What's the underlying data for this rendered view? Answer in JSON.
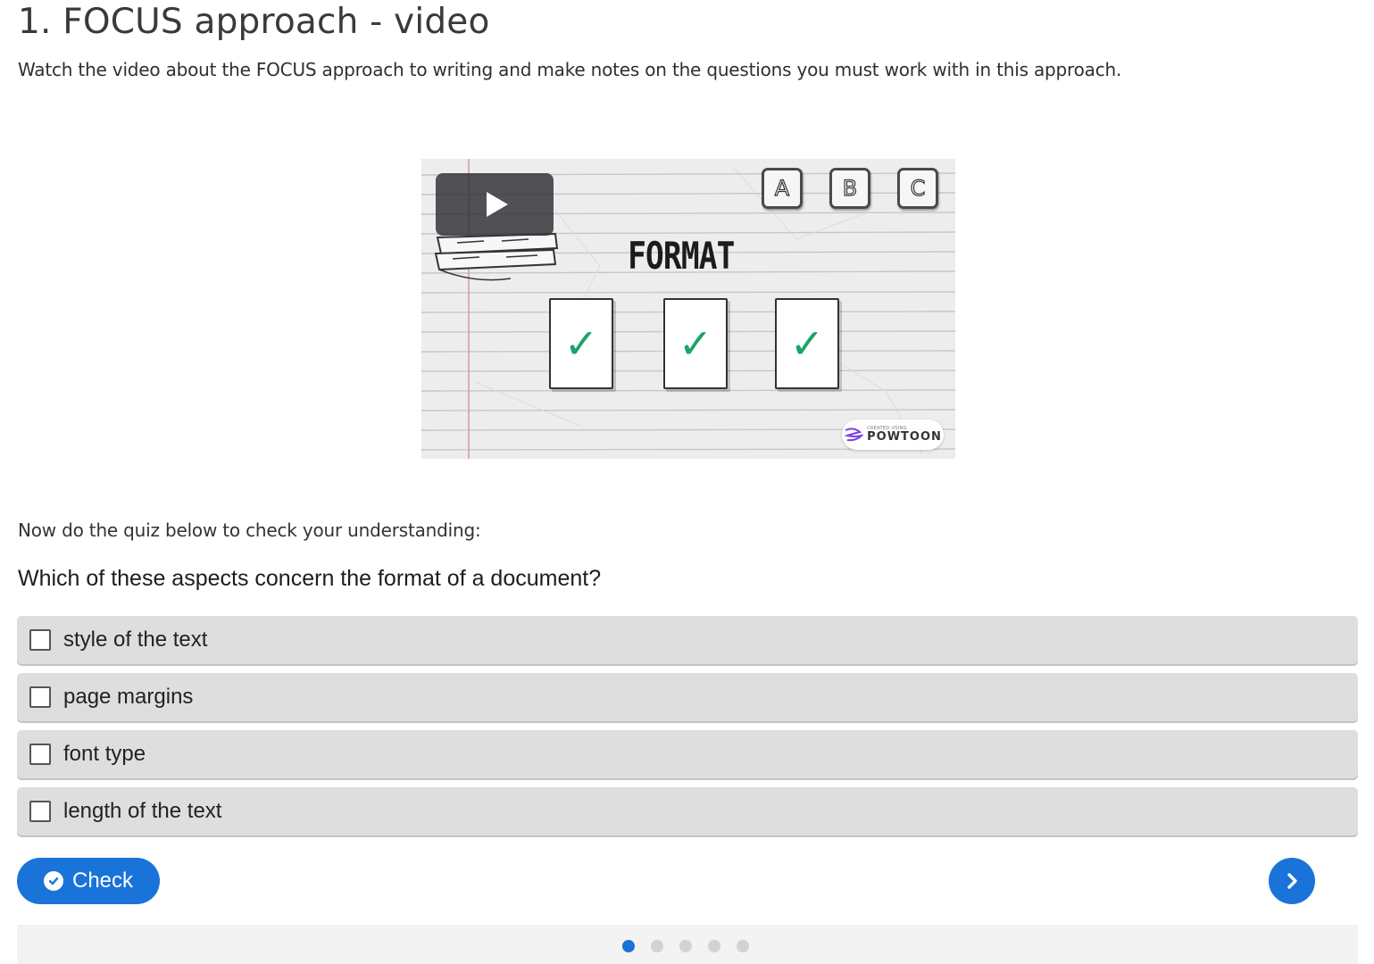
{
  "header": {
    "title": "1. FOCUS approach - video",
    "intro": "Watch the video about the FOCUS approach to writing and make notes on the questions you must work with in this approach."
  },
  "video": {
    "headline": "FORMAT",
    "badges": [
      "A",
      "B",
      "C"
    ],
    "checkmarks": [
      "✓",
      "✓",
      "✓"
    ],
    "watermark_small": "CREATED USING",
    "watermark_name": "POWTOON",
    "play_icon": "play-icon"
  },
  "quiz": {
    "intro": "Now do the quiz below to check your understanding:",
    "question": "Which of these aspects concern the format of a document?",
    "options": [
      {
        "label": "style of the text",
        "checked": false
      },
      {
        "label": "page margins",
        "checked": false
      },
      {
        "label": "font type",
        "checked": false
      },
      {
        "label": "length of the text",
        "checked": false
      }
    ],
    "check_label": "Check",
    "check_icon": "check-circle-icon",
    "next_icon": "chevron-right-icon"
  },
  "pagination": {
    "total": 5,
    "active_index": 0
  },
  "colors": {
    "accent": "#1a73d9",
    "option_bg": "#dedede",
    "checkmark": "#1aa468"
  }
}
